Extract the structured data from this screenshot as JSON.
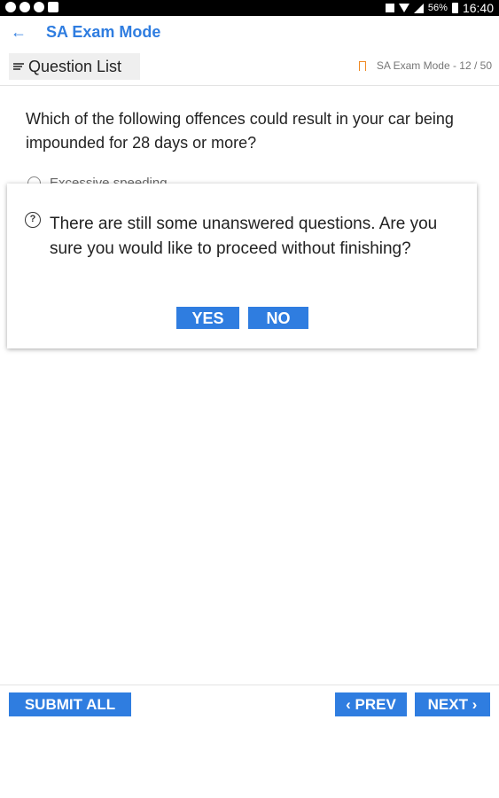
{
  "status_bar": {
    "battery_text": "56%",
    "time": "16:40"
  },
  "app_bar": {
    "back_glyph": "←",
    "title": "SA Exam Mode"
  },
  "sub_bar": {
    "question_list_label": "Question List",
    "progress_text": "SA Exam Mode - 12 / 50"
  },
  "question": {
    "text": "Which of the following offences could result in your car being impounded for 28 days or more?",
    "options": [
      {
        "label": "Excessive speeding"
      }
    ]
  },
  "dialog": {
    "icon_glyph": "?",
    "message": "There are still some unanswered questions. Are you sure you would like to proceed without finishing?",
    "yes_label": "YES",
    "no_label": "NO"
  },
  "bottom_bar": {
    "submit_label": "SUBMIT ALL",
    "prev_label": "‹ PREV",
    "next_label": "NEXT ›"
  },
  "colors": {
    "accent": "#2f7de0",
    "bookmark": "#f08a24"
  },
  "icons": {
    "back": "back-arrow-icon",
    "list": "list-icon",
    "bookmark": "bookmark-icon",
    "help": "help-icon"
  }
}
